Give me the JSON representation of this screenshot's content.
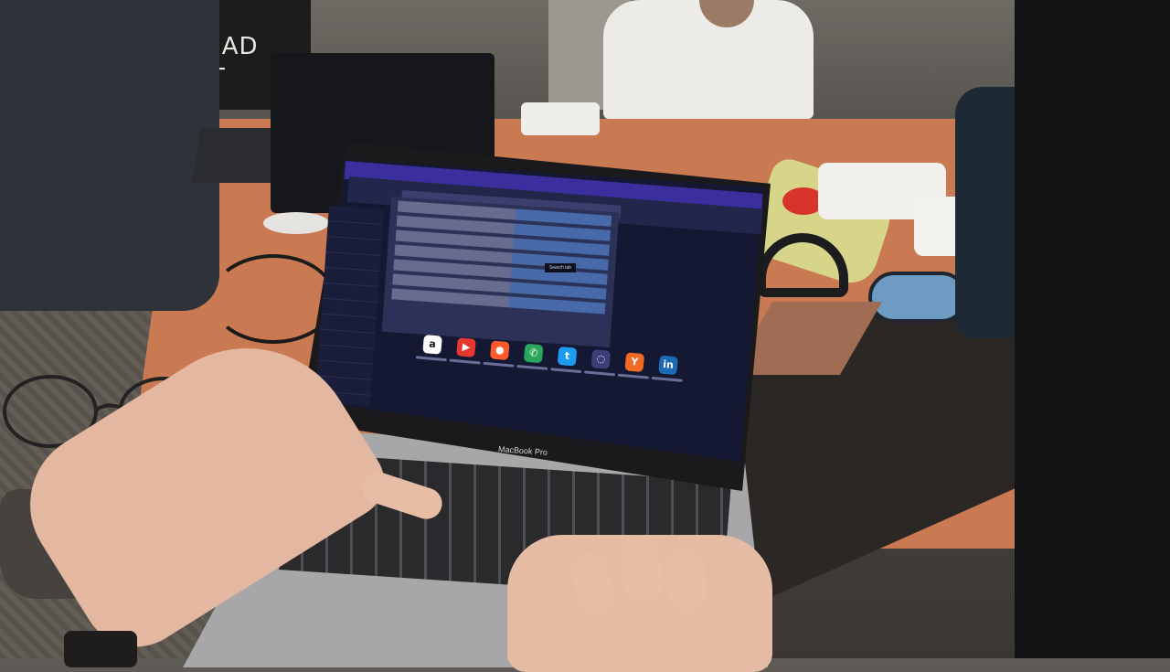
{
  "scene": {
    "shirt_text_line1": "YOU READ",
    "shirt_text_line2": "Y SHIRT",
    "laptop_brand": "MacBook Pro"
  },
  "browser": {
    "tooltip": "Search tab"
  },
  "shortcuts": [
    {
      "icon": "amazon-icon",
      "glyph": "a",
      "color": "#ffffff",
      "fg": "#111111"
    },
    {
      "icon": "youtube-icon",
      "glyph": "▶",
      "color": "#e5392f",
      "fg": "#ffffff"
    },
    {
      "icon": "reddit-icon",
      "glyph": "●",
      "color": "#ff5a2c",
      "fg": "#ffffff"
    },
    {
      "icon": "whatsapp-icon",
      "glyph": "✆",
      "color": "#2aa55b",
      "fg": "#ffffff"
    },
    {
      "icon": "twitter-icon",
      "glyph": "t",
      "color": "#1d9bf0",
      "fg": "#ffffff"
    },
    {
      "icon": "chat-icon",
      "glyph": "◌",
      "color": "#3a3f78",
      "fg": "#ffffff"
    },
    {
      "icon": "ycombinator-icon",
      "glyph": "Y",
      "color": "#f06a23",
      "fg": "#ffffff"
    },
    {
      "icon": "linkedin-icon",
      "glyph": "in",
      "color": "#1c6bb5",
      "fg": "#ffffff"
    }
  ]
}
